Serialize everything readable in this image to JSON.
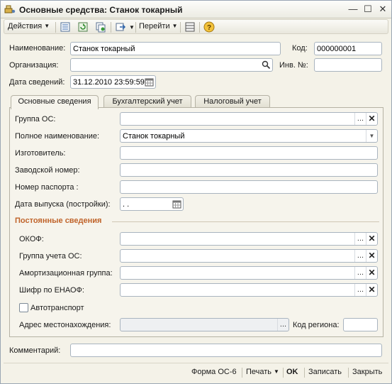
{
  "window": {
    "title": "Основные средства: Станок токарный",
    "controls": {
      "minimize": "—",
      "maximize": "☐",
      "close": "✕"
    }
  },
  "toolbar": {
    "actions_label": "Действия",
    "goto_label": "Перейти",
    "icons": [
      "list-icon",
      "refresh-icon",
      "copy-icon",
      "go-icon",
      "structure-icon",
      "help-icon"
    ]
  },
  "header": {
    "name_label": "Наименование:",
    "name_value": "Станок токарный",
    "code_label": "Код:",
    "code_value": "000000001",
    "org_label": "Организация:",
    "org_value": "",
    "inv_label": "Инв. №:",
    "inv_value": "",
    "date_label": "Дата сведений:",
    "date_value": "31.12.2010 23:59:59"
  },
  "tabs": [
    {
      "label": "Основные сведения",
      "active": true
    },
    {
      "label": "Бухгалтерский учет",
      "active": false
    },
    {
      "label": "Налоговый учет",
      "active": false
    }
  ],
  "main": {
    "group_label": "Группа ОС:",
    "group_value": "",
    "fullname_label": "Полное наименование:",
    "fullname_value": "Станок токарный",
    "manufacturer_label": "Изготовитель:",
    "manufacturer_value": "",
    "serial_label": "Заводской номер:",
    "serial_value": "",
    "passport_label": "Номер паспорта :",
    "passport_value": "",
    "release_label": "Дата выпуска (постройки):",
    "release_value": " .  ."
  },
  "permanent": {
    "title": "Постоянные сведения",
    "okof_label": "ОКОФ:",
    "okof_value": "",
    "account_group_label": "Группа учета ОС:",
    "account_group_value": "",
    "amort_label": "Амортизационная группа:",
    "amort_value": "",
    "cipher_label": "Шифр по ЕНАОФ:",
    "cipher_value": "",
    "vehicle_label": "Автотранспорт",
    "vehicle_checked": false,
    "address_label": "Адрес местонахождения:",
    "address_value": "",
    "region_label": "Код региона:",
    "region_value": ""
  },
  "comment": {
    "label": "Комментарий:",
    "value": ""
  },
  "footer": {
    "form_label": "Форма ОС-6",
    "print_label": "Печать",
    "ok_label": "OK",
    "save_label": "Записать",
    "close_label": "Закрыть"
  },
  "field_buttons": {
    "select": "...",
    "clear": "✕",
    "search": "⚲",
    "dropdown": "▼"
  }
}
